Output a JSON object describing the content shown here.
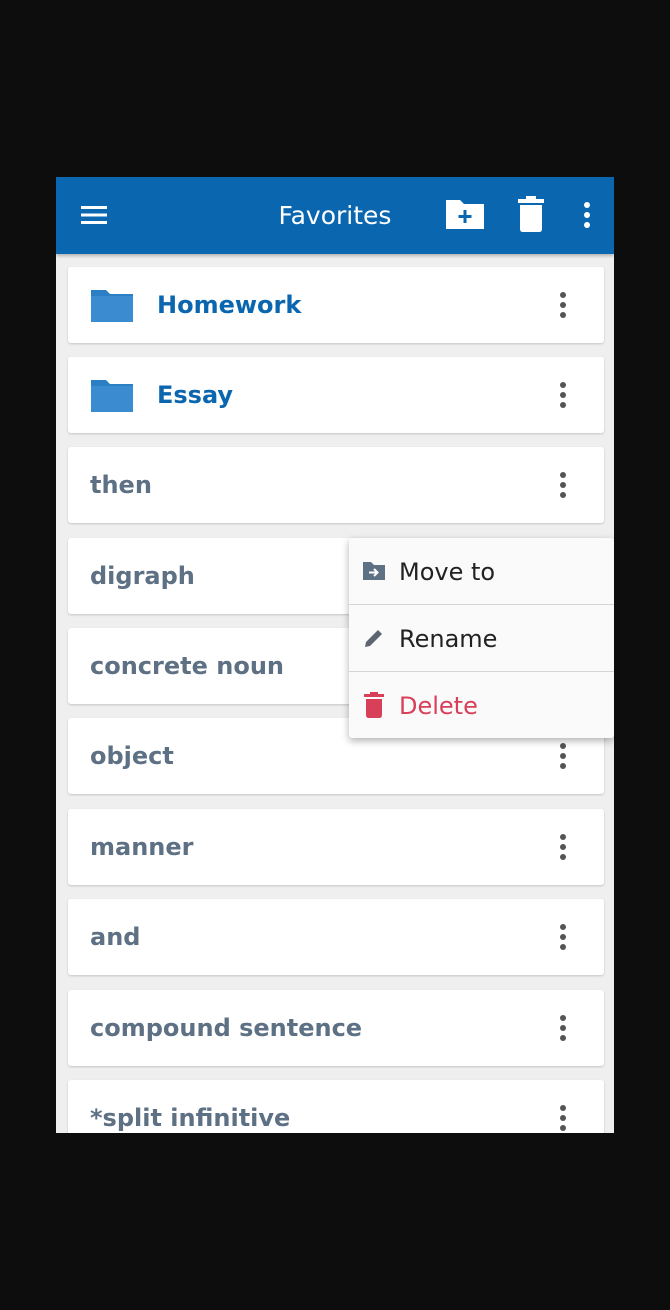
{
  "appbar": {
    "title": "Favorites",
    "icons": [
      "hamburger-menu-icon",
      "new-folder-icon",
      "trash-icon",
      "more-vertical-icon"
    ],
    "color": "#0b66b0"
  },
  "list": {
    "items": [
      {
        "label": "Homework",
        "type": "folder"
      },
      {
        "label": "Essay",
        "type": "folder"
      },
      {
        "label": "then",
        "type": "word"
      },
      {
        "label": "digraph",
        "type": "word"
      },
      {
        "label": "concrete noun",
        "type": "word"
      },
      {
        "label": "object",
        "type": "word"
      },
      {
        "label": "manner",
        "type": "word"
      },
      {
        "label": "and",
        "type": "word"
      },
      {
        "label": "compound sentence",
        "type": "word"
      },
      {
        "label": "*split infinitive",
        "type": "word"
      }
    ]
  },
  "context_menu": {
    "items": [
      {
        "label": "Move to",
        "icon": "move-to-folder-icon"
      },
      {
        "label": "Rename",
        "icon": "pencil-icon"
      },
      {
        "label": "Delete",
        "icon": "trash-icon",
        "color": "#d8405a"
      }
    ]
  },
  "colors": {
    "folder_text": "#0b66b0",
    "word_text": "#5d7084",
    "background": "#efefef"
  }
}
